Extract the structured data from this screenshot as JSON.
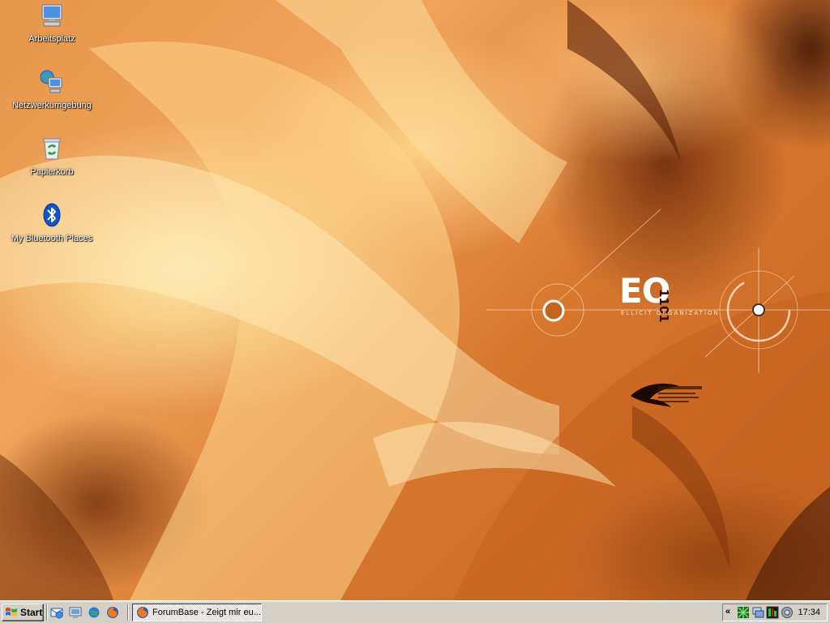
{
  "desktop": {
    "icons": [
      {
        "label": "Arbeitsplatz",
        "icon": "my-computer-icon"
      },
      {
        "label": "Netzwerkumgebung",
        "icon": "network-places-icon"
      },
      {
        "label": "Papierkorb",
        "icon": "recycle-bin-icon"
      },
      {
        "label": "My Bluetooth Places",
        "icon": "bluetooth-icon"
      }
    ],
    "wallpaper": {
      "logo_text": "EO",
      "logo_number": "1101",
      "logo_subtitle": "ELLICIT ORGANIZATION"
    }
  },
  "taskbar": {
    "start_label": "Start",
    "quick_launch": [
      "outlook-express-icon",
      "show-desktop-icon",
      "internet-explorer-icon",
      "firefox-icon"
    ],
    "tasks": [
      {
        "label": "ForumBase - Zeigt mir eu...",
        "icon": "firefox-icon"
      }
    ],
    "tray": {
      "expand_label": "«",
      "icons": [
        "network-icon",
        "monitor-icon",
        "cpu-meter-icon",
        "volume-icon"
      ],
      "clock": "17:34"
    }
  },
  "colors": {
    "wallpaper_base": "#d8782f",
    "taskbar": "#d4d0c8",
    "label_text": "#ffffff"
  }
}
